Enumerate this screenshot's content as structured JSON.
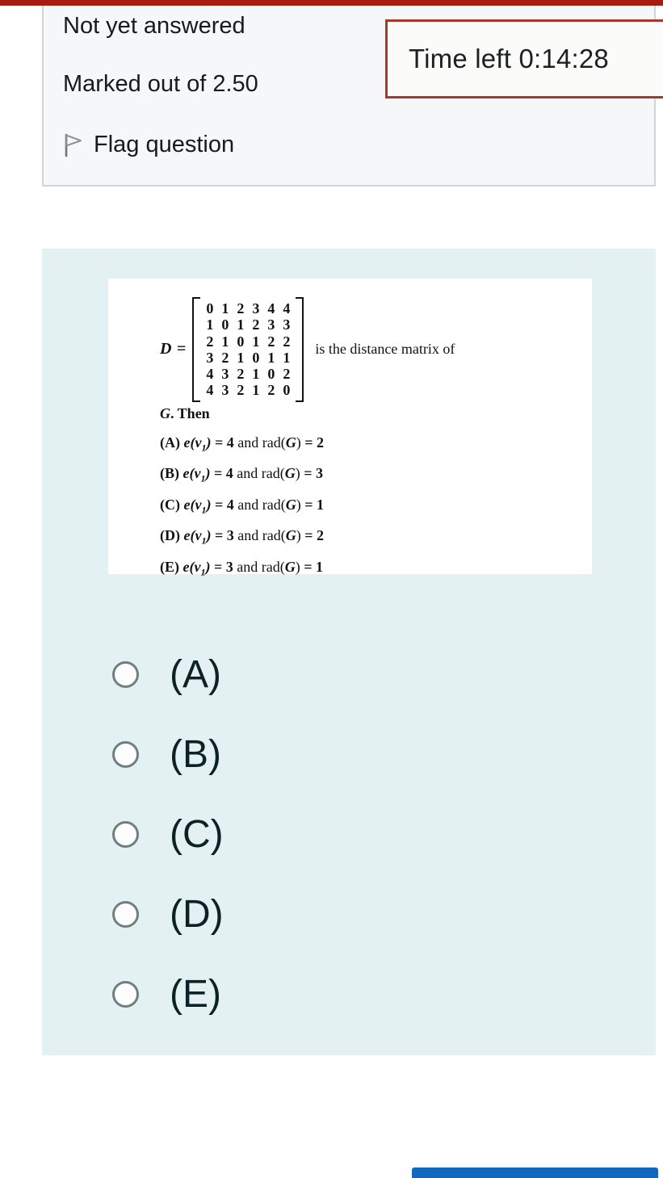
{
  "top_bar": {
    "color": "#a81c10"
  },
  "question_info": {
    "status": "Not yet answered",
    "marks": "Marked out of 2.50",
    "flag_label": "Flag question",
    "flag_icon": "flag-outline-icon"
  },
  "timer": {
    "label": "Time left 0:14:28",
    "border_color": "#a6382c"
  },
  "question": {
    "background_color": "#e3f1f3",
    "stem": {
      "matrix_label": "D",
      "equals": "=",
      "matrix_rows": [
        [
          "0",
          "1",
          "2",
          "3",
          "4",
          "4"
        ],
        [
          "1",
          "0",
          "1",
          "2",
          "3",
          "3"
        ],
        [
          "2",
          "1",
          "0",
          "1",
          "2",
          "2"
        ],
        [
          "3",
          "2",
          "1",
          "0",
          "1",
          "1"
        ],
        [
          "4",
          "3",
          "2",
          "1",
          "0",
          "2"
        ],
        [
          "4",
          "3",
          "2",
          "1",
          "2",
          "0"
        ]
      ],
      "tail_text": "is the distance matrix of",
      "then_prefix": "G",
      "then_text": ". Then",
      "choices": [
        {
          "tag": "(A)",
          "func": "e",
          "var": "v",
          "sub": "1",
          "close": ")",
          "eq1": "= 4",
          "and": "and",
          "rad": "rad(",
          "radvar": "G",
          "radclose": ")",
          "eq2": "= 2"
        },
        {
          "tag": "(B)",
          "func": "e",
          "var": "v",
          "sub": "1",
          "close": ")",
          "eq1": "= 4",
          "and": "and",
          "rad": "rad(",
          "radvar": "G",
          "radclose": ")",
          "eq2": "= 3"
        },
        {
          "tag": "(C)",
          "func": "e",
          "var": "v",
          "sub": "1",
          "close": ")",
          "eq1": "= 4",
          "and": "and",
          "rad": "rad(",
          "radvar": "G",
          "radclose": ")",
          "eq2": "= 1"
        },
        {
          "tag": "(D)",
          "func": "e",
          "var": "v",
          "sub": "1",
          "close": ")",
          "eq1": "= 3",
          "and": "and",
          "rad": "rad(",
          "radvar": "G",
          "radclose": ")",
          "eq2": "= 2"
        },
        {
          "tag": "(E)",
          "func": "e",
          "var": "v",
          "sub": "1",
          "close": ")",
          "eq1": "= 3",
          "and": "and",
          "rad": "rad(",
          "radvar": "G",
          "radclose": ")",
          "eq2": "= 1"
        }
      ]
    },
    "answers": [
      {
        "label": "(A)",
        "selected": false
      },
      {
        "label": "(B)",
        "selected": false
      },
      {
        "label": "(C)",
        "selected": false
      },
      {
        "label": "(D)",
        "selected": false
      },
      {
        "label": "(E)",
        "selected": false
      }
    ]
  },
  "bottom_button": {
    "color": "#1069bc"
  }
}
